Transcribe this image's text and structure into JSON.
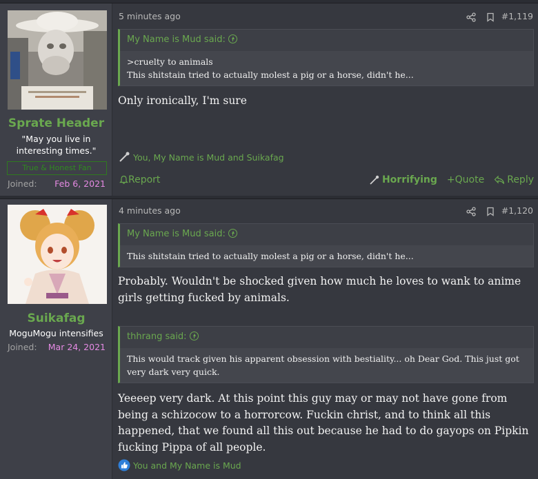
{
  "posts": [
    {
      "user": {
        "name": "Sprate Header",
        "title": "\"May you live in interesting times.\"",
        "banner": "True & Honest Fan",
        "joined_label": "Joined:",
        "joined_date": "Feb 6, 2021"
      },
      "time": "5 minutes ago",
      "number": "#1,119",
      "quotes": [
        {
          "author": "My Name is Mud said:",
          "lines": [
            ">cruelty to animals",
            "This shitstain tried to actually molest a pig or a horse, didn't he..."
          ]
        }
      ],
      "message": [
        "Only ironically, I'm sure"
      ],
      "reactions": "You, My Name is Mud and Suikafag",
      "actions": {
        "report": "Report",
        "reaction": "Horrifying",
        "quote": "+Quote",
        "reply": "Reply"
      }
    },
    {
      "user": {
        "name": "Suikafag",
        "title": "MoguMogu intensifies",
        "joined_label": "Joined:",
        "joined_date": "Mar 24, 2021"
      },
      "time": "4 minutes ago",
      "number": "#1,120",
      "quotes": [
        {
          "author": "My Name is Mud said:",
          "lines": [
            "This shitstain tried to actually molest a pig or a horse, didn't he..."
          ]
        },
        {
          "author": "thhrang said:",
          "lines": [
            "This would track given his apparent obsession with bestiality... oh Dear God. This just got very dark very quick."
          ]
        }
      ],
      "message": [
        "Probably. Wouldn't be shocked given how much he loves to wank to anime girls getting fucked by animals."
      ],
      "message2": [
        "Yeeeep very dark. At this point this guy may or may not have gone from being a schizocow to a horrorcow. Fuckin christ, and to think all this happened, that we found all this out because he had to do gayops on Pipkin fucking Pippa of all people."
      ],
      "reactions": "You and My Name is Mud"
    }
  ],
  "colors": {
    "accent": "#6aa84f",
    "date": "#e58ae3",
    "background": "#36383f"
  }
}
